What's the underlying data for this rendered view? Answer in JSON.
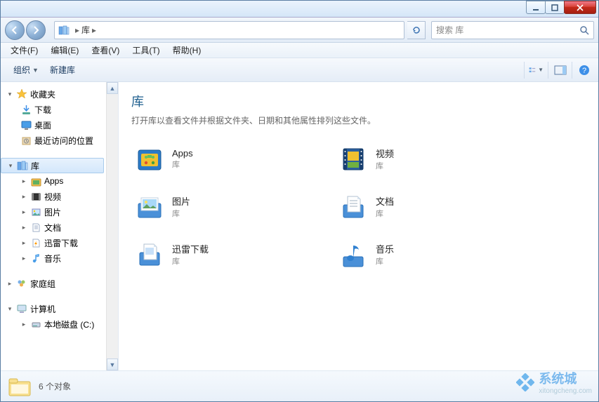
{
  "titlebar": {
    "minimize_tip": "最小化",
    "maximize_tip": "最大化",
    "close_tip": "关闭"
  },
  "address": {
    "segments": [
      "库"
    ],
    "arrow": "▸",
    "refresh_tip": "刷新"
  },
  "search": {
    "placeholder": "搜索 库"
  },
  "menubar": {
    "file": "文件(F)",
    "edit": "编辑(E)",
    "view": "查看(V)",
    "tools": "工具(T)",
    "help": "帮助(H)"
  },
  "toolbar": {
    "organize": "组织",
    "new_library": "新建库",
    "view_options_tip": "更改视图",
    "preview_pane_tip": "显示预览窗格",
    "help_tip": "获取帮助"
  },
  "sidebar": {
    "favorites_label": "收藏夹",
    "favorites": [
      {
        "icon": "download-icon",
        "label": "下载"
      },
      {
        "icon": "desktop-icon",
        "label": "桌面"
      },
      {
        "icon": "recent-icon",
        "label": "最近访问的位置"
      }
    ],
    "libraries_label": "库",
    "libraries": [
      {
        "icon": "apps-icon",
        "label": "Apps"
      },
      {
        "icon": "video-icon",
        "label": "视频"
      },
      {
        "icon": "pictures-icon",
        "label": "图片"
      },
      {
        "icon": "documents-icon",
        "label": "文档"
      },
      {
        "icon": "thunder-icon",
        "label": "迅雷下载"
      },
      {
        "icon": "music-icon",
        "label": "音乐"
      }
    ],
    "homegroup_label": "家庭组",
    "computer_label": "计算机",
    "computer_children": [
      {
        "icon": "disk-icon",
        "label": "本地磁盘 (C:)"
      }
    ]
  },
  "content": {
    "title": "库",
    "description": "打开库以查看文件并根据文件夹、日期和其他属性排列这些文件。",
    "sub_label": "库",
    "items": [
      {
        "icon": "apps-icon",
        "name": "Apps"
      },
      {
        "icon": "video-icon",
        "name": "视频"
      },
      {
        "icon": "pictures-icon",
        "name": "图片"
      },
      {
        "icon": "documents-icon",
        "name": "文档"
      },
      {
        "icon": "thunder-icon",
        "name": "迅雷下载"
      },
      {
        "icon": "music-icon",
        "name": "音乐"
      }
    ]
  },
  "statusbar": {
    "count_text": "6 个对象"
  },
  "watermark": {
    "main": "系统城",
    "sub": "xitongcheng.com"
  }
}
